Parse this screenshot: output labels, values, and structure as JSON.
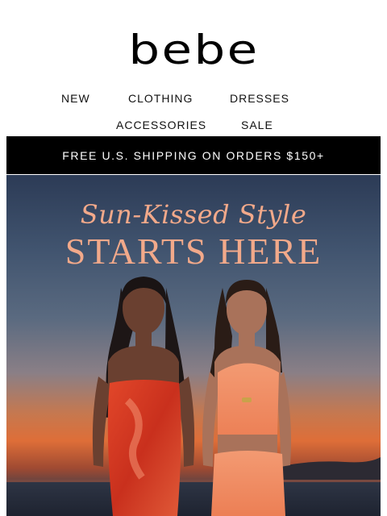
{
  "brand": {
    "logo_text": "bebe"
  },
  "nav": {
    "row1": [
      "NEW",
      "CLOTHING",
      "DRESSES"
    ],
    "row2": [
      "ACCESSORIES",
      "SALE"
    ]
  },
  "promo_bar": {
    "text": "FREE U.S. SHIPPING ON ORDERS $150+"
  },
  "hero": {
    "script_line": "Sun-Kissed Style",
    "headline": "STARTS HERE"
  },
  "colors": {
    "accent_peach": "#f2a98a",
    "promo_bar_bg": "#000000",
    "red_dress": "#d93a22",
    "coral_outfit": "#f08a63"
  }
}
